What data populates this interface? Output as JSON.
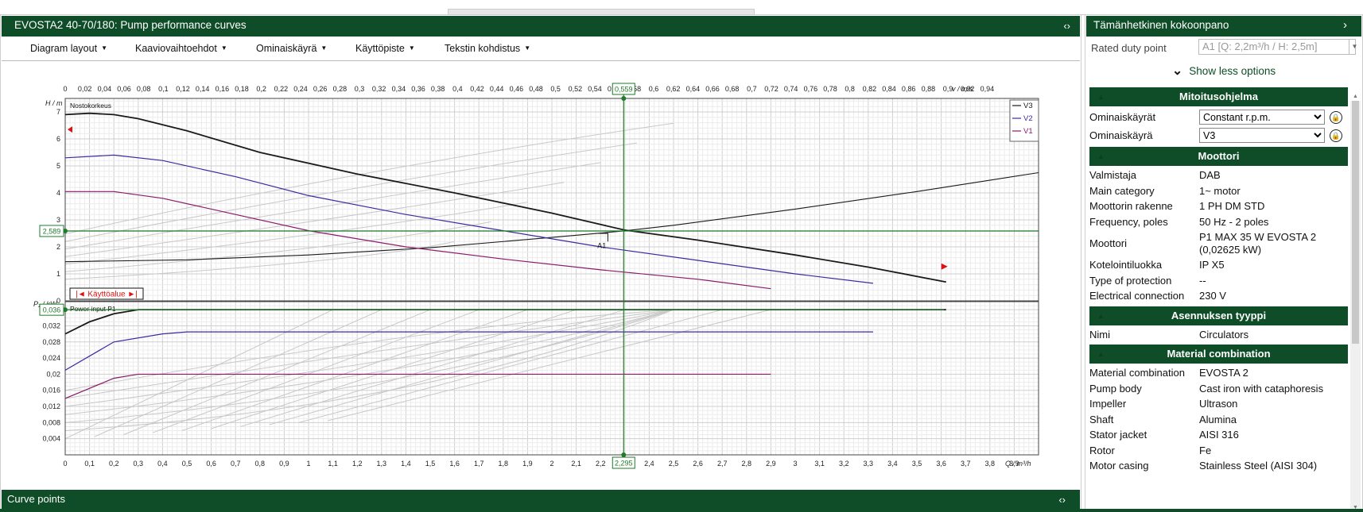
{
  "window": {
    "title": "EVOSTA2 40-70/180: Pump performance curves",
    "collapse_glyph": "‹›"
  },
  "menu": [
    {
      "label": "Diagram layout"
    },
    {
      "label": "Kaaviovaihtoehdot"
    },
    {
      "label": "Ominaiskäyrä"
    },
    {
      "label": "Käyttöpiste"
    },
    {
      "label": "Tekstin kohdistus"
    }
  ],
  "chart_data": {
    "type": "line",
    "title": "",
    "top_axis": {
      "label": "v / m/s",
      "min": 0,
      "max": 0.96,
      "ticks": [
        "0",
        "0,02",
        "0,04",
        "0,06",
        "0,08",
        "0,1",
        "0,12",
        "0,14",
        "0,16",
        "0,18",
        "0,2",
        "0,22",
        "0,24",
        "0,26",
        "0,28",
        "0,3",
        "0,32",
        "0,34",
        "0,36",
        "0,38",
        "0,4",
        "0,42",
        "0,44",
        "0,46",
        "0,48",
        "0,5",
        "0,52",
        "0,54",
        "0,56",
        "0,58",
        "0,6",
        "0,62",
        "0,64",
        "0,66",
        "0,68",
        "0,7",
        "0,72",
        "0,74",
        "0,76",
        "0,78",
        "0,8",
        "0,82",
        "0,84",
        "0,86",
        "0,88",
        "0,9",
        "0,92",
        "0,94",
        "v / m/s"
      ]
    },
    "x_axis": {
      "label": "Q / m³/h",
      "min": 0,
      "max": 4.0,
      "ticks": [
        "0",
        "0,1",
        "0,2",
        "0,3",
        "0,4",
        "0,5",
        "0,6",
        "0,7",
        "0,8",
        "0,9",
        "1",
        "1,1",
        "1,2",
        "1,3",
        "1,4",
        "1,5",
        "1,6",
        "1,7",
        "1,8",
        "1,9",
        "2",
        "2,1",
        "2,2",
        "2,3",
        "2,4",
        "2,5",
        "2,6",
        "2,7",
        "2,8",
        "2,9",
        "3",
        "3,1",
        "3,2",
        "3,3",
        "3,4",
        "3,5",
        "3,6",
        "3,7",
        "3,8",
        "3,9",
        "Q / m³/h"
      ]
    },
    "head_panel": {
      "ylabel": "H / m",
      "panel_label": "Nostokorkeus",
      "ylim": [
        0,
        7.5
      ],
      "yticks": [
        "0",
        "1",
        "2",
        "3",
        "4",
        "5",
        "6",
        "7"
      ],
      "series": [
        {
          "name": "V3",
          "color": "#1a1a1a",
          "x": [
            0,
            0.1,
            0.2,
            0.3,
            0.5,
            0.8,
            1.2,
            1.6,
            2.0,
            2.3,
            2.6,
            3.0,
            3.3,
            3.62
          ],
          "y": [
            6.9,
            6.95,
            6.9,
            6.75,
            6.3,
            5.5,
            4.7,
            4.0,
            3.25,
            2.62,
            2.25,
            1.7,
            1.25,
            0.7
          ]
        },
        {
          "name": "V2",
          "color": "#3a2aa0",
          "x": [
            0,
            0.2,
            0.4,
            0.7,
            1.0,
            1.4,
            1.8,
            2.2,
            2.6,
            3.0,
            3.32
          ],
          "y": [
            5.3,
            5.4,
            5.2,
            4.6,
            3.9,
            3.2,
            2.6,
            2.0,
            1.5,
            1.0,
            0.65
          ]
        },
        {
          "name": "V1",
          "color": "#8a1a6a",
          "x": [
            0,
            0.2,
            0.4,
            0.7,
            1.0,
            1.4,
            1.8,
            2.2,
            2.6,
            2.9
          ],
          "y": [
            4.05,
            4.05,
            3.8,
            3.2,
            2.6,
            2.0,
            1.55,
            1.15,
            0.8,
            0.45
          ]
        }
      ],
      "system_curve": {
        "color": "#1a1a1a",
        "x": [
          0,
          0.5,
          1.0,
          1.5,
          2.0,
          2.295,
          2.5,
          3.0,
          3.5,
          4.0
        ],
        "y": [
          1.45,
          1.52,
          1.7,
          1.97,
          2.35,
          2.589,
          2.8,
          3.4,
          4.05,
          4.75
        ]
      },
      "duty_point": {
        "label": "A1",
        "q": 2.295,
        "h": 2.589,
        "v": 0.559
      },
      "range_label": "|◄ Käyttöalue ►|",
      "legend": [
        "V3",
        "V2",
        "V1"
      ]
    },
    "power_panel": {
      "ylabel": "P₁ / kW",
      "panel_label": "Power input P1",
      "ylim": [
        0,
        0.038
      ],
      "yticks": [
        "0,004",
        "0,008",
        "0,012",
        "0,016",
        "0,02",
        "0,024",
        "0,028",
        "0,032"
      ],
      "series": [
        {
          "name": "V3",
          "color": "#1a1a1a",
          "x": [
            0,
            0.1,
            0.2,
            0.3,
            3.62
          ],
          "y": [
            0.03,
            0.033,
            0.035,
            0.036,
            0.036
          ]
        },
        {
          "name": "V2",
          "color": "#3a2aa0",
          "x": [
            0,
            0.2,
            0.4,
            0.5,
            3.32
          ],
          "y": [
            0.021,
            0.028,
            0.03,
            0.0305,
            0.0305
          ]
        },
        {
          "name": "V1",
          "color": "#8a1a6a",
          "x": [
            0,
            0.2,
            0.3,
            2.9
          ],
          "y": [
            0.014,
            0.019,
            0.02,
            0.02
          ]
        }
      ],
      "duty_point": {
        "p": 0.036
      }
    },
    "markers": {
      "h_value": "2,589",
      "p_value": "0,036",
      "q_value": "2,295",
      "v_value": "0,559"
    }
  },
  "curve_points": {
    "title": "Curve points"
  },
  "config": {
    "title": "Tämänhetkinen kokoonpano",
    "rated_duty_label": "Rated duty point",
    "rated_duty_value": "A1 [Q: 2,2m³/h / H: 2,5m]",
    "show_less": "Show less options",
    "sections": {
      "mitoitus": "Mitoitusohjelma",
      "moottori": "Moottori",
      "asennus": "Asennuksen tyyppi",
      "material": "Material combination"
    },
    "ominaiskayrat_label": "Ominaiskäyrät",
    "ominaiskayrat_value": "Constant r.p.m.",
    "ominaiskayra_label": "Ominaiskäyrä",
    "ominaiskayra_value": "V3",
    "motor_rows": [
      {
        "k": "Valmistaja",
        "v": "DAB"
      },
      {
        "k": "Main category",
        "v": "1~ motor"
      },
      {
        "k": "Moottorin rakenne",
        "v": "1 PH DM STD"
      },
      {
        "k": "Frequency, poles",
        "v": "50 Hz - 2 poles"
      },
      {
        "k": "Moottori",
        "v": "P1 MAX 35 W EVOSTA 2 (0,02625 kW)"
      },
      {
        "k": "Kotelointiluokka",
        "v": "IP X5"
      },
      {
        "k": "Type of protection",
        "v": "--"
      },
      {
        "k": "Electrical connection",
        "v": "230 V"
      }
    ],
    "install_rows": [
      {
        "k": "Nimi",
        "v": "Circulators"
      }
    ],
    "material_rows": [
      {
        "k": "Material combination",
        "v": "EVOSTA 2"
      },
      {
        "k": "Pump body",
        "v": "Cast iron with cataphoresis"
      },
      {
        "k": "Impeller",
        "v": "Ultrason"
      },
      {
        "k": "Shaft",
        "v": "Alumina"
      },
      {
        "k": "Stator jacket",
        "v": "AISI 316"
      },
      {
        "k": "Rotor",
        "v": "Fe"
      },
      {
        "k": "Motor casing",
        "v": "Stainless Steel (AISI 304)"
      }
    ]
  }
}
